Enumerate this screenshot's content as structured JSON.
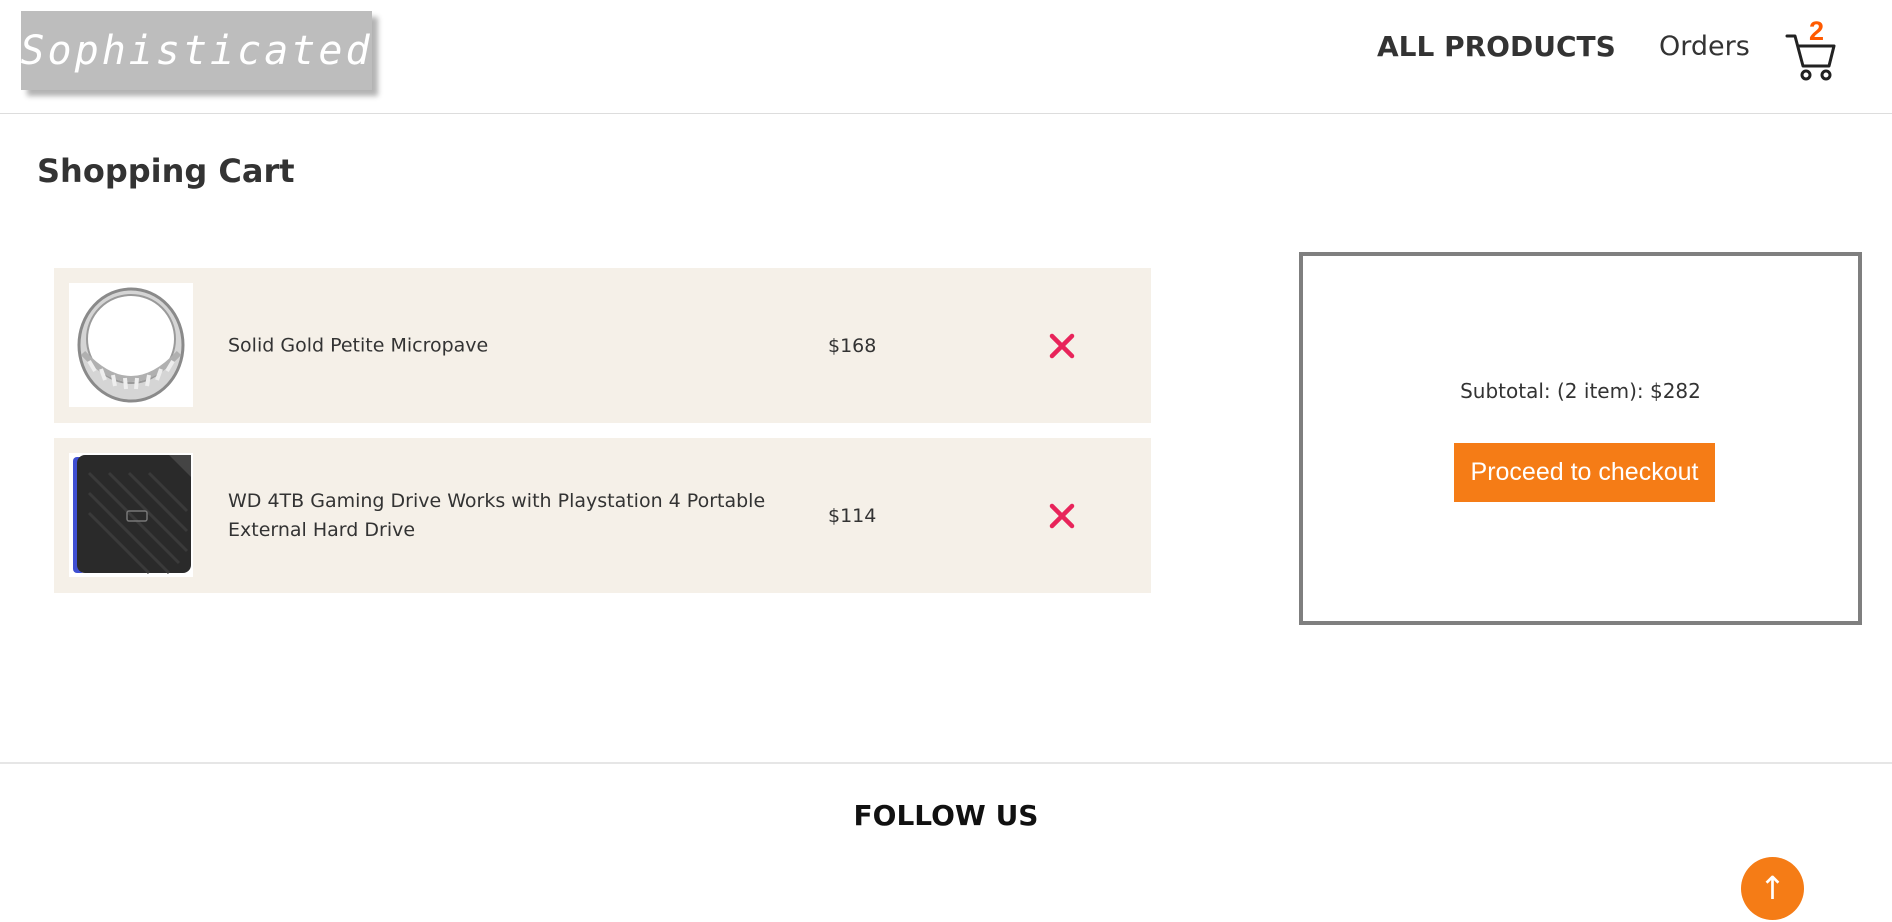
{
  "header": {
    "logo_text": "Sophisticated",
    "nav_all_products": "ALL PRODUCTS",
    "nav_orders": "Orders",
    "cart_count": "2"
  },
  "page_title": "Shopping Cart",
  "cart_items": [
    {
      "name": "Solid Gold Petite Micropave",
      "price": "$168",
      "image": "silver-ring"
    },
    {
      "name": "WD 4TB Gaming Drive Works with Playstation 4 Portable External Hard Drive",
      "price": "$114",
      "image": "black-hard-drive"
    }
  ],
  "summary": {
    "subtotal_text": "Subtotal: (2 item): $282",
    "checkout_label": "Proceed to checkout"
  },
  "footer": {
    "follow_label": "FOLLOW US",
    "scroll_top_label": "↑"
  },
  "colors": {
    "accent": "#f57c16",
    "cart_count": "#ff5a00",
    "remove_icon": "#e8245a",
    "item_bg": "#f5f0e8",
    "logo_bg": "#bdbdbd",
    "summary_border": "#7f7f7f"
  }
}
